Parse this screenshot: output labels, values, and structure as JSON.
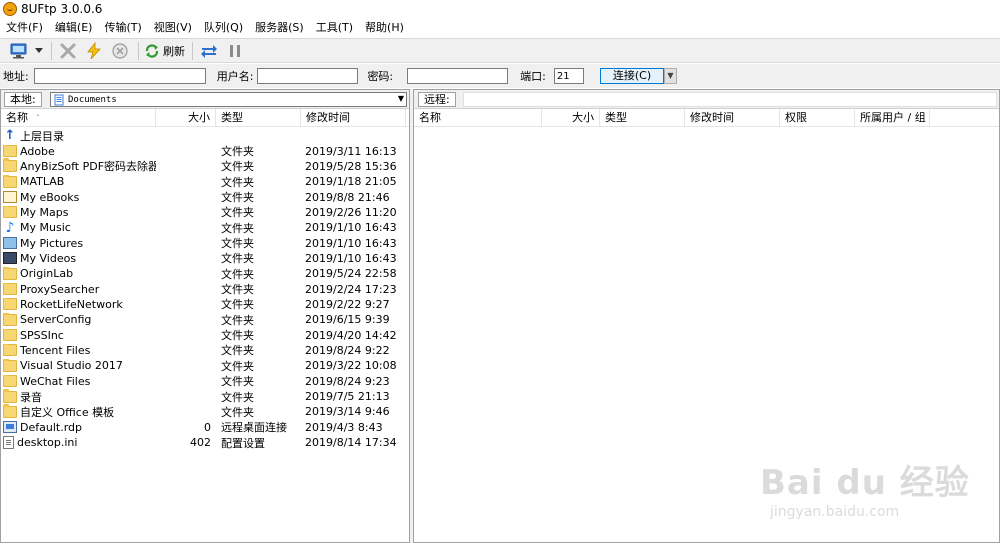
{
  "window": {
    "title": "8UFtp 3.0.0.6"
  },
  "menu": [
    "文件(F)",
    "编辑(E)",
    "传输(T)",
    "视图(V)",
    "队列(Q)",
    "服务器(S)",
    "工具(T)",
    "帮助(H)"
  ],
  "toolbar": {
    "refresh_label": "刷新"
  },
  "connection": {
    "address_label": "地址:",
    "address_value": "",
    "user_label": "用户名:",
    "user_value": "",
    "password_label": "密码:",
    "password_value": "",
    "port_label": "端口:",
    "port_value": "21",
    "connect_label": "连接(C)"
  },
  "local": {
    "label": "本地:",
    "path": "Documents",
    "columns": [
      "名称",
      "大小",
      "类型",
      "修改时间"
    ],
    "rows": [
      {
        "icon": "up-arrow-icon",
        "name": "上层目录",
        "size": "",
        "type": "",
        "modified": ""
      },
      {
        "icon": "folder-icon",
        "name": "Adobe",
        "size": "",
        "type": "文件夹",
        "modified": "2019/3/11 16:13"
      },
      {
        "icon": "folder-icon",
        "name": "AnyBizSoft PDF密码去除器...",
        "size": "",
        "type": "文件夹",
        "modified": "2019/5/28 15:36"
      },
      {
        "icon": "folder-icon",
        "name": "MATLAB",
        "size": "",
        "type": "文件夹",
        "modified": "2019/1/18 21:05"
      },
      {
        "icon": "ebook-folder-icon",
        "name": "My eBooks",
        "size": "",
        "type": "文件夹",
        "modified": "2019/8/8 21:46"
      },
      {
        "icon": "folder-icon",
        "name": "My Maps",
        "size": "",
        "type": "文件夹",
        "modified": "2019/2/26 11:20"
      },
      {
        "icon": "music-folder-icon",
        "name": "My Music",
        "size": "",
        "type": "文件夹",
        "modified": "2019/1/10 16:43"
      },
      {
        "icon": "pictures-folder-icon",
        "name": "My Pictures",
        "size": "",
        "type": "文件夹",
        "modified": "2019/1/10 16:43"
      },
      {
        "icon": "videos-folder-icon",
        "name": "My Videos",
        "size": "",
        "type": "文件夹",
        "modified": "2019/1/10 16:43"
      },
      {
        "icon": "folder-icon",
        "name": "OriginLab",
        "size": "",
        "type": "文件夹",
        "modified": "2019/5/24 22:58"
      },
      {
        "icon": "folder-icon",
        "name": "ProxySearcher",
        "size": "",
        "type": "文件夹",
        "modified": "2019/2/24 17:23"
      },
      {
        "icon": "folder-icon",
        "name": "RocketLifeNetwork",
        "size": "",
        "type": "文件夹",
        "modified": "2019/2/22 9:27"
      },
      {
        "icon": "folder-icon",
        "name": "ServerConfig",
        "size": "",
        "type": "文件夹",
        "modified": "2019/6/15 9:39"
      },
      {
        "icon": "folder-icon",
        "name": "SPSSInc",
        "size": "",
        "type": "文件夹",
        "modified": "2019/4/20 14:42"
      },
      {
        "icon": "folder-icon",
        "name": "Tencent Files",
        "size": "",
        "type": "文件夹",
        "modified": "2019/8/24 9:22"
      },
      {
        "icon": "folder-icon",
        "name": "Visual Studio 2017",
        "size": "",
        "type": "文件夹",
        "modified": "2019/3/22 10:08"
      },
      {
        "icon": "folder-icon",
        "name": "WeChat Files",
        "size": "",
        "type": "文件夹",
        "modified": "2019/8/24 9:23"
      },
      {
        "icon": "folder-icon",
        "name": "录音",
        "size": "",
        "type": "文件夹",
        "modified": "2019/7/5 21:13"
      },
      {
        "icon": "folder-icon",
        "name": "自定义 Office 模板",
        "size": "",
        "type": "文件夹",
        "modified": "2019/3/14 9:46"
      },
      {
        "icon": "rdp-file-icon",
        "name": "Default.rdp",
        "size": "0",
        "type": "远程桌面连接",
        "modified": "2019/4/3 8:43"
      },
      {
        "icon": "ini-file-icon",
        "name": "desktop.ini",
        "size": "402",
        "type": "配置设置",
        "modified": "2019/8/14 17:34"
      }
    ]
  },
  "remote": {
    "label": "远程:",
    "columns": [
      "名称",
      "大小",
      "类型",
      "修改时间",
      "权限",
      "所属用户 / 组"
    ]
  },
  "watermark": {
    "main": "Bai du 经验",
    "sub": "jingyan.baidu.com"
  }
}
